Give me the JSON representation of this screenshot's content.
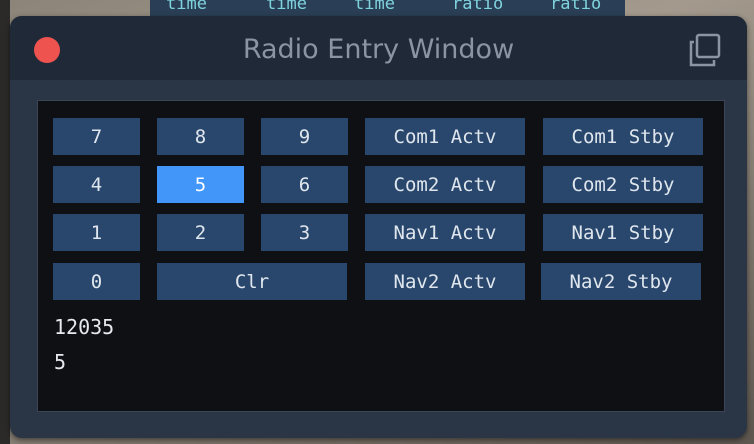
{
  "background": {
    "header_cells": [
      "time",
      "time",
      "time",
      "ratio",
      "ratio"
    ]
  },
  "window": {
    "title": "Radio Entry Window",
    "close_color": "#ef5350",
    "button_color": "#29476c",
    "active_button_color": "#4296fa"
  },
  "keypad": {
    "k7": "7",
    "k8": "8",
    "k9": "9",
    "k4": "4",
    "k5": "5",
    "k6": "6",
    "k1": "1",
    "k2": "2",
    "k3": "3",
    "k0": "0",
    "clr": "Clr",
    "active_key": "5"
  },
  "radios": {
    "com1_actv": "Com1 Actv",
    "com1_stby": "Com1 Stby",
    "com2_actv": "Com2 Actv",
    "com2_stby": "Com2 Stby",
    "nav1_actv": "Nav1 Actv",
    "nav1_stby": "Nav1 Stby",
    "nav2_actv": "Nav2 Actv",
    "nav2_stby": "Nav2 Stby"
  },
  "readout": {
    "frequency": "12035",
    "last_key": "5"
  }
}
